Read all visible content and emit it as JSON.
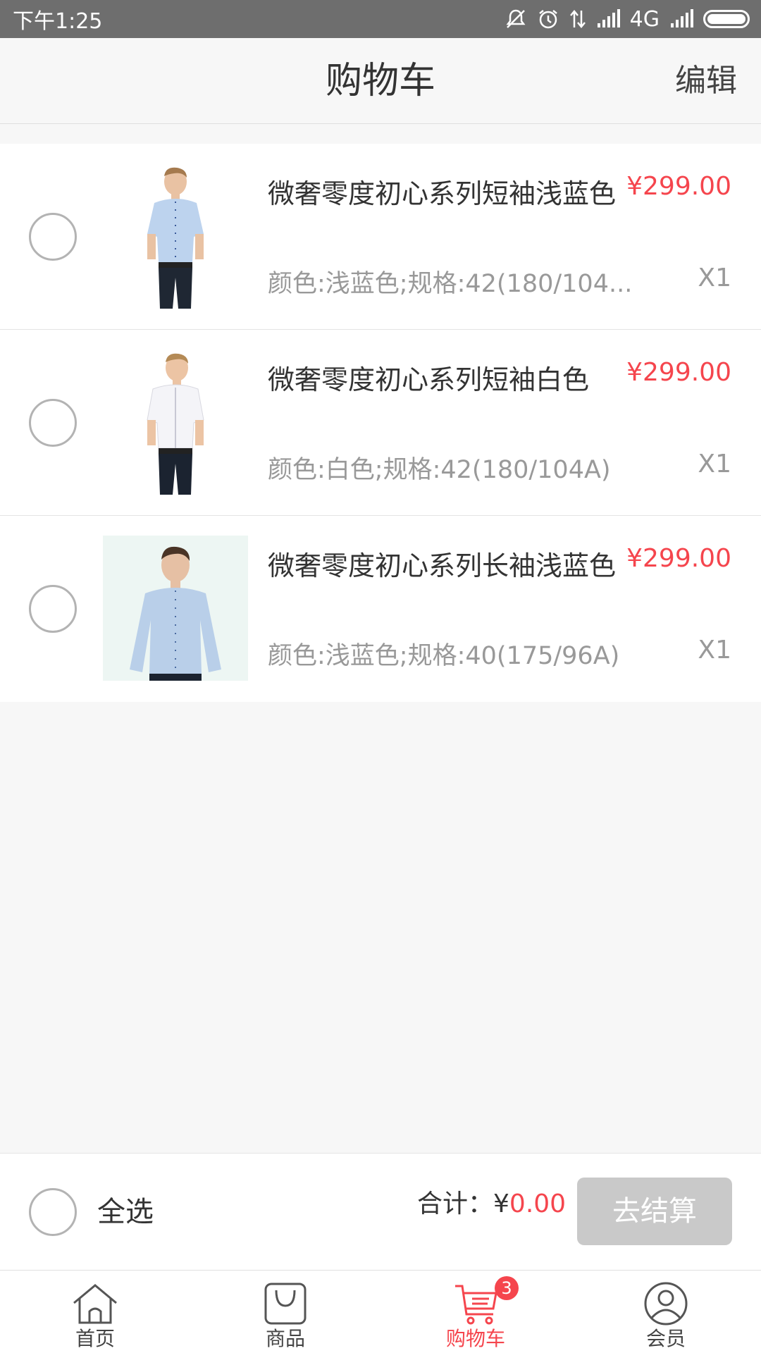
{
  "status_bar": {
    "time": "下午1:25",
    "network": "4G",
    "icons": [
      "mute-icon",
      "alarm-icon",
      "data-transfer-icon",
      "signal-icon",
      "signal-icon",
      "battery-icon"
    ]
  },
  "nav": {
    "title": "购物车",
    "edit_label": "编辑"
  },
  "cart": {
    "items": [
      {
        "name": "微奢零度初心系列短袖浅蓝色",
        "price": "¥299.00",
        "spec": "颜色:浅蓝色;规格:42(180/104...",
        "qty": "X1",
        "shirt_color": "#bdd3ee",
        "sleeve": "short"
      },
      {
        "name": "微奢零度初心系列短袖白色",
        "price": "¥299.00",
        "spec": "颜色:白色;规格:42(180/104A)",
        "qty": "X1",
        "shirt_color": "#f4f4f8",
        "sleeve": "short"
      },
      {
        "name": "微奢零度初心系列长袖浅蓝色",
        "price": "¥299.00",
        "spec": "颜色:浅蓝色;规格:40(175/96A)",
        "qty": "X1",
        "shirt_color": "#b9cfe9",
        "sleeve": "long"
      }
    ]
  },
  "checkout": {
    "select_all_label": "全选",
    "total_label": "合计：",
    "total_currency": "¥",
    "total_amount": "0.00",
    "button_label": "去结算"
  },
  "tabs": [
    {
      "label": "首页",
      "icon": "home-icon"
    },
    {
      "label": "商品",
      "icon": "shopping-bag-icon"
    },
    {
      "label": "购物车",
      "icon": "cart-icon",
      "badge": "3",
      "active": true
    },
    {
      "label": "会员",
      "icon": "user-icon"
    }
  ],
  "colors": {
    "accent": "#f5454d",
    "status_bar": "#6e6e6e",
    "button_disabled": "#c9c9c9"
  }
}
